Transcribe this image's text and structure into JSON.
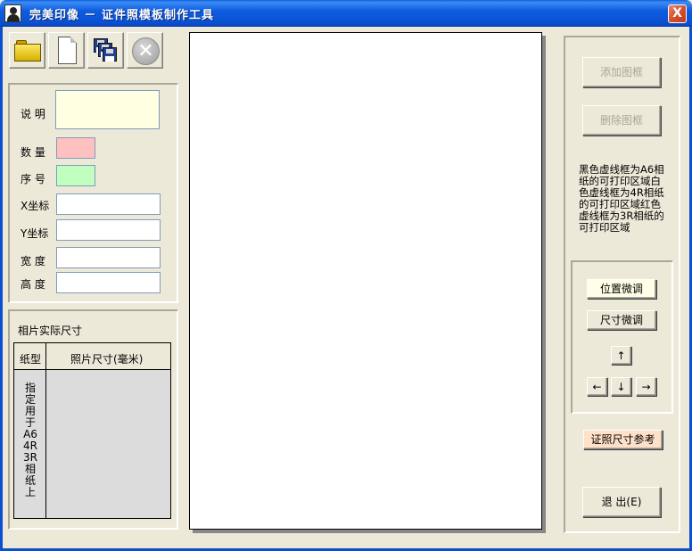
{
  "window": {
    "title": "完美印像 － 证件照模板制作工具",
    "close_label": "X"
  },
  "toolbar": {
    "open_icon": "folder-open-icon",
    "new_icon": "new-document-icon",
    "save_icon": "save-disks-icon",
    "cancel_icon": "cancel-circle-icon",
    "cancel_glyph": "✕"
  },
  "properties": {
    "description_label": "说 明",
    "quantity_label": "数 量",
    "serial_label": "序 号",
    "x_label": "X坐标",
    "y_label": "Y坐标",
    "width_label": "宽 度",
    "height_label": "高 度",
    "description_value": "",
    "quantity_value": "",
    "serial_value": "",
    "x_value": "",
    "y_value": "",
    "width_value": "",
    "height_value": ""
  },
  "actual_size": {
    "heading": "相片实际尺寸",
    "col_paper": "纸型",
    "col_photo_size": "照片尺寸(毫米)",
    "paper_note": "指定用于A6 4R 3R相纸上"
  },
  "right_panel": {
    "add_frame": "添加图框",
    "delete_frame": "删除图框",
    "note_1": "黑色虚线框为A6相纸的可打印区域",
    "note_2": "白色虚线框为4R相纸的可打印区域",
    "note_3": "红色虚线框为3R相纸的可打印区域",
    "position_adjust": "位置微调",
    "size_adjust": "尺寸微调",
    "arrow_up": "↑",
    "arrow_left": "←",
    "arrow_down": "↓",
    "arrow_right": "→",
    "id_size_reference": "证照尺寸参考",
    "exit": "退 出(E)"
  }
}
